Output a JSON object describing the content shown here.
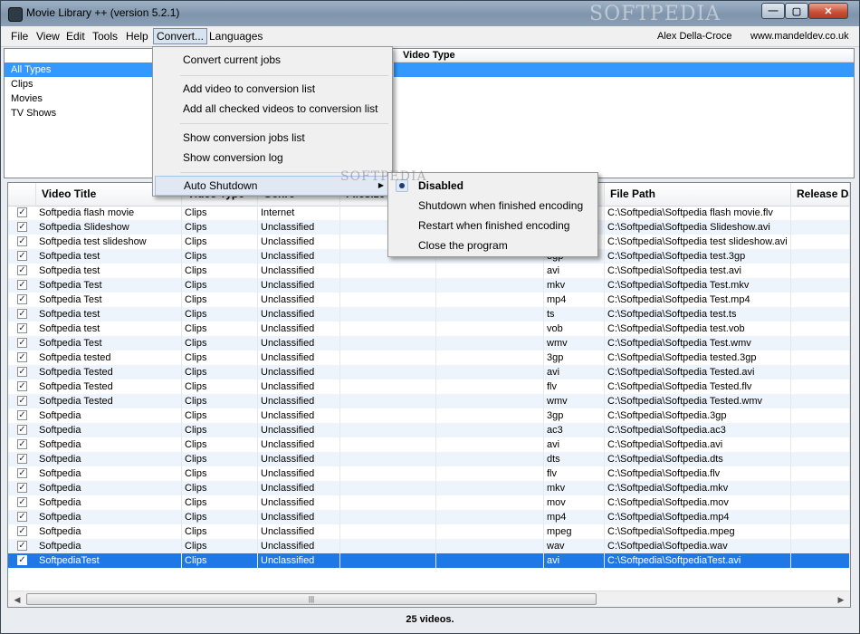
{
  "window": {
    "title": "Movie Library ++ (version 5.2.1)",
    "watermark": "SOFTPEDIA",
    "minimize_label": "—",
    "maximize_label": "▢",
    "close_label": "✕"
  },
  "menu": {
    "items": [
      "File",
      "View",
      "Edit",
      "Tools",
      "Help",
      "Convert...",
      "Languages"
    ],
    "author": "Alex Della-Croce",
    "website": "www.mandeldev.co.uk"
  },
  "types": {
    "items": [
      "All Types",
      "Clips",
      "Movies",
      "TV Shows"
    ],
    "selected_index": 0,
    "video_type_header": "Video Type"
  },
  "convert_menu": {
    "items": [
      "Convert current jobs",
      "Add video to conversion list",
      "Add all checked videos to conversion list",
      "Show conversion jobs list",
      "Show conversion log",
      "Auto Shutdown"
    ],
    "submenu_arrow": "▶",
    "auto_shutdown_options": [
      "Disabled",
      "Shutdown when finished encoding",
      "Restart when finished encoding",
      "Close the program"
    ],
    "selected_option": "Disabled",
    "watermark": "SOFTPEDIA"
  },
  "table": {
    "columns": [
      "Video Title",
      "Video Type",
      "Genre",
      "Filesize",
      "",
      "",
      "File Path",
      "Release Date"
    ],
    "check_mark": "✓",
    "rows": [
      {
        "title": "Softpedia flash movie",
        "type": "Clips",
        "genre": "Internet",
        "ext": "",
        "path": "C:\\Softpedia\\Softpedia flash movie.flv"
      },
      {
        "title": "Softpedia Slideshow",
        "type": "Clips",
        "genre": "Unclassified",
        "ext": "",
        "path": "C:\\Softpedia\\Softpedia Slideshow.avi"
      },
      {
        "title": "Softpedia test slideshow",
        "type": "Clips",
        "genre": "Unclassified",
        "ext": "",
        "path": "C:\\Softpedia\\Softpedia test slideshow.avi"
      },
      {
        "title": "Softpedia test",
        "type": "Clips",
        "genre": "Unclassified",
        "ext": "3gp",
        "path": "C:\\Softpedia\\Softpedia test.3gp"
      },
      {
        "title": "Softpedia test",
        "type": "Clips",
        "genre": "Unclassified",
        "ext": "avi",
        "path": "C:\\Softpedia\\Softpedia test.avi"
      },
      {
        "title": "Softpedia Test",
        "type": "Clips",
        "genre": "Unclassified",
        "ext": "mkv",
        "path": "C:\\Softpedia\\Softpedia Test.mkv"
      },
      {
        "title": "Softpedia Test",
        "type": "Clips",
        "genre": "Unclassified",
        "ext": "mp4",
        "path": "C:\\Softpedia\\Softpedia Test.mp4"
      },
      {
        "title": "Softpedia test",
        "type": "Clips",
        "genre": "Unclassified",
        "ext": "ts",
        "path": "C:\\Softpedia\\Softpedia test.ts"
      },
      {
        "title": "Softpedia test",
        "type": "Clips",
        "genre": "Unclassified",
        "ext": "vob",
        "path": "C:\\Softpedia\\Softpedia test.vob"
      },
      {
        "title": "Softpedia Test",
        "type": "Clips",
        "genre": "Unclassified",
        "ext": "wmv",
        "path": "C:\\Softpedia\\Softpedia Test.wmv"
      },
      {
        "title": "Softpedia tested",
        "type": "Clips",
        "genre": "Unclassified",
        "ext": "3gp",
        "path": "C:\\Softpedia\\Softpedia tested.3gp"
      },
      {
        "title": "Softpedia Tested",
        "type": "Clips",
        "genre": "Unclassified",
        "ext": "avi",
        "path": "C:\\Softpedia\\Softpedia Tested.avi"
      },
      {
        "title": "Softpedia Tested",
        "type": "Clips",
        "genre": "Unclassified",
        "ext": "flv",
        "path": "C:\\Softpedia\\Softpedia Tested.flv"
      },
      {
        "title": "Softpedia Tested",
        "type": "Clips",
        "genre": "Unclassified",
        "ext": "wmv",
        "path": "C:\\Softpedia\\Softpedia Tested.wmv"
      },
      {
        "title": "Softpedia",
        "type": "Clips",
        "genre": "Unclassified",
        "ext": "3gp",
        "path": "C:\\Softpedia\\Softpedia.3gp"
      },
      {
        "title": "Softpedia",
        "type": "Clips",
        "genre": "Unclassified",
        "ext": "ac3",
        "path": "C:\\Softpedia\\Softpedia.ac3"
      },
      {
        "title": "Softpedia",
        "type": "Clips",
        "genre": "Unclassified",
        "ext": "avi",
        "path": "C:\\Softpedia\\Softpedia.avi"
      },
      {
        "title": "Softpedia",
        "type": "Clips",
        "genre": "Unclassified",
        "ext": "dts",
        "path": "C:\\Softpedia\\Softpedia.dts"
      },
      {
        "title": "Softpedia",
        "type": "Clips",
        "genre": "Unclassified",
        "ext": "flv",
        "path": "C:\\Softpedia\\Softpedia.flv"
      },
      {
        "title": "Softpedia",
        "type": "Clips",
        "genre": "Unclassified",
        "ext": "mkv",
        "path": "C:\\Softpedia\\Softpedia.mkv"
      },
      {
        "title": "Softpedia",
        "type": "Clips",
        "genre": "Unclassified",
        "ext": "mov",
        "path": "C:\\Softpedia\\Softpedia.mov"
      },
      {
        "title": "Softpedia",
        "type": "Clips",
        "genre": "Unclassified",
        "ext": "mp4",
        "path": "C:\\Softpedia\\Softpedia.mp4"
      },
      {
        "title": "Softpedia",
        "type": "Clips",
        "genre": "Unclassified",
        "ext": "mpeg",
        "path": "C:\\Softpedia\\Softpedia.mpeg"
      },
      {
        "title": "Softpedia",
        "type": "Clips",
        "genre": "Unclassified",
        "ext": "wav",
        "path": "C:\\Softpedia\\Softpedia.wav"
      },
      {
        "title": "SoftpediaTest",
        "type": "Clips",
        "genre": "Unclassified",
        "ext": "avi",
        "path": "C:\\Softpedia\\SoftpediaTest.avi"
      }
    ],
    "selected_row_index": 24,
    "scroll_grip": "|||"
  },
  "status": {
    "text": "25 videos."
  }
}
